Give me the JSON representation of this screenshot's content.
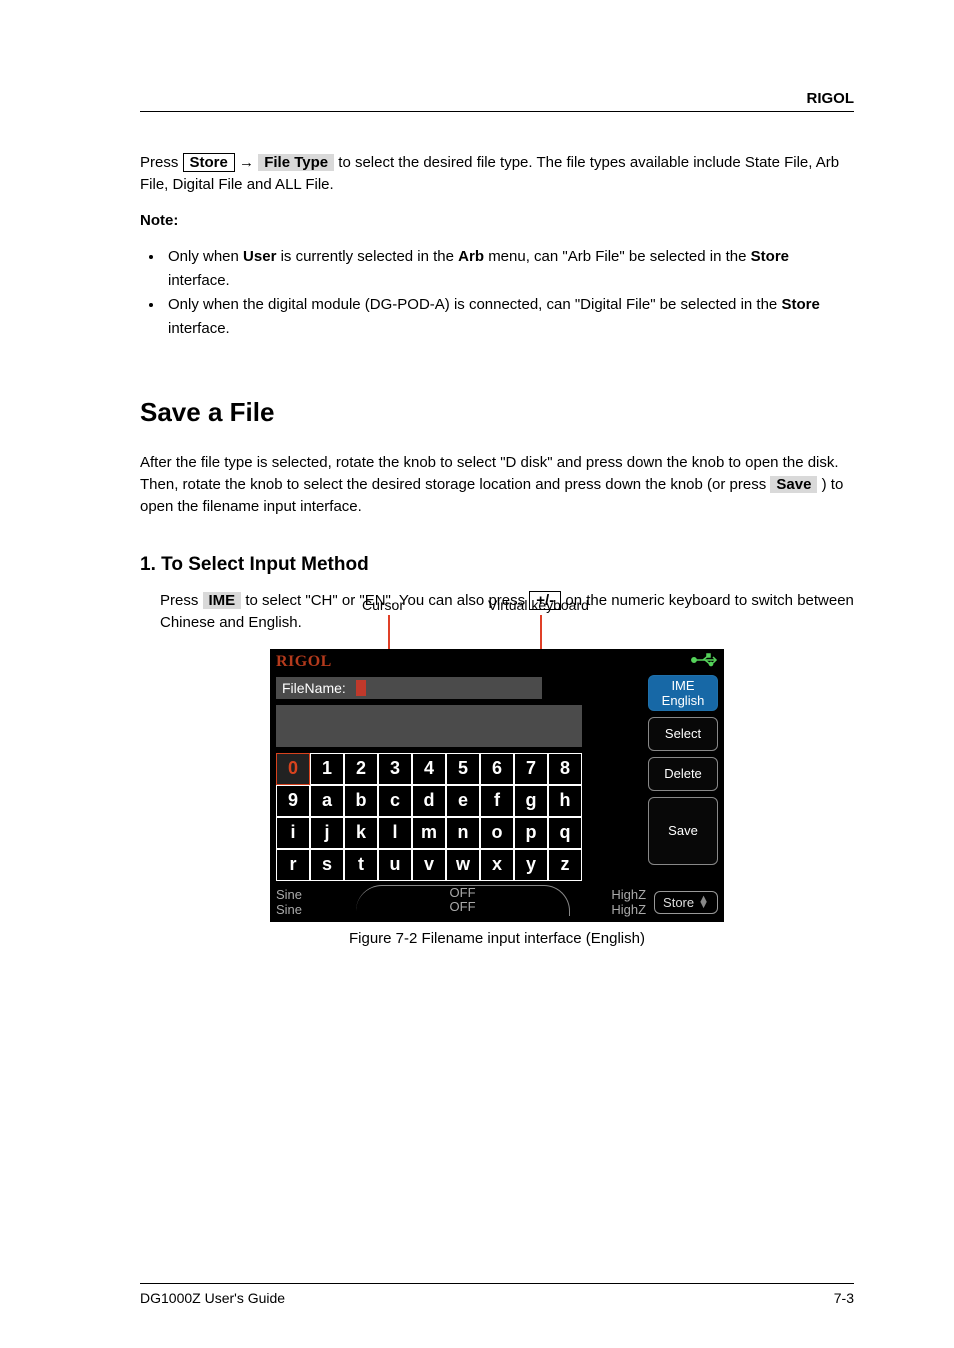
{
  "header": {
    "brand": "RIGOL"
  },
  "intro_prefix": "Press ",
  "intro_btn1": "Store",
  "arrow": "→",
  "intro_btn2": "File Type",
  "intro_suffix1": " to select the desired file type. The file types available include State File, Arb File, Digital File and ALL File.",
  "note": "Note:",
  "bullet1_a": "Only when ",
  "bullet1_b": "User",
  "bullet1_c": " is currently selected in the ",
  "bullet1_d": "Arb",
  "bullet1_e": " menu, can \"Arb File\" be selected in the ",
  "bullet1_f": "Store",
  "bullet1_g": " interface.",
  "bullet2_a": "Only when the digital module (DG-POD-A) is connected, can \"Digital File\" be selected in the ",
  "bullet2_b": "Store",
  "bullet2_c": " interface.",
  "h1": "Save a File",
  "para2": "After the file type is selected, rotate the knob to select \"D disk\" and press down the knob to open the disk. Then, rotate the knob to select the desired storage location and press down the knob (or press",
  "para2_btn_save": "Save",
  "para2_tail": ") to open the filename input interface.",
  "h2": "1. To Select Input Method",
  "step1_a": "Press ",
  "step1_btn1": "IME",
  "step1_b": " to select \"CH\" or \"EN\". You can also press ",
  "step1_btn2": "+/-",
  "step1_c": " on the numeric keyboard to switch between Chinese and English.",
  "callouts": {
    "cursor": "Cursor",
    "virtual": "Virtual keyboard"
  },
  "screenshot": {
    "brand": "RIGOL",
    "usb_glyph": "⊷↔",
    "filename_label": "FileName:",
    "softkeys": {
      "ime_top": "IME",
      "ime_bottom": "English",
      "select": "Select",
      "delete": "Delete",
      "save": "Save"
    },
    "keys_row1": [
      "0",
      "1",
      "2",
      "3",
      "4",
      "5",
      "6",
      "7",
      "8"
    ],
    "keys_row2": [
      "9",
      "a",
      "b",
      "c",
      "d",
      "e",
      "f",
      "g",
      "h"
    ],
    "keys_row3": [
      "i",
      "j",
      "k",
      "l",
      "m",
      "n",
      "o",
      "p",
      "q"
    ],
    "keys_row4": [
      "r",
      "s",
      "t",
      "u",
      "v",
      "w",
      "x",
      "y",
      "z"
    ],
    "selected_key_index": 0,
    "status_left_1": "Sine",
    "status_left_2": "Sine",
    "status_mid_1": "OFF",
    "status_mid_2": "OFF",
    "status_right_1": "HighZ",
    "status_right_2": "HighZ",
    "status_store": "Store"
  },
  "caption": "Figure 7-2 Filename input interface (English)",
  "footer_left": "DG1000Z User's Guide",
  "footer_right": "7-3"
}
